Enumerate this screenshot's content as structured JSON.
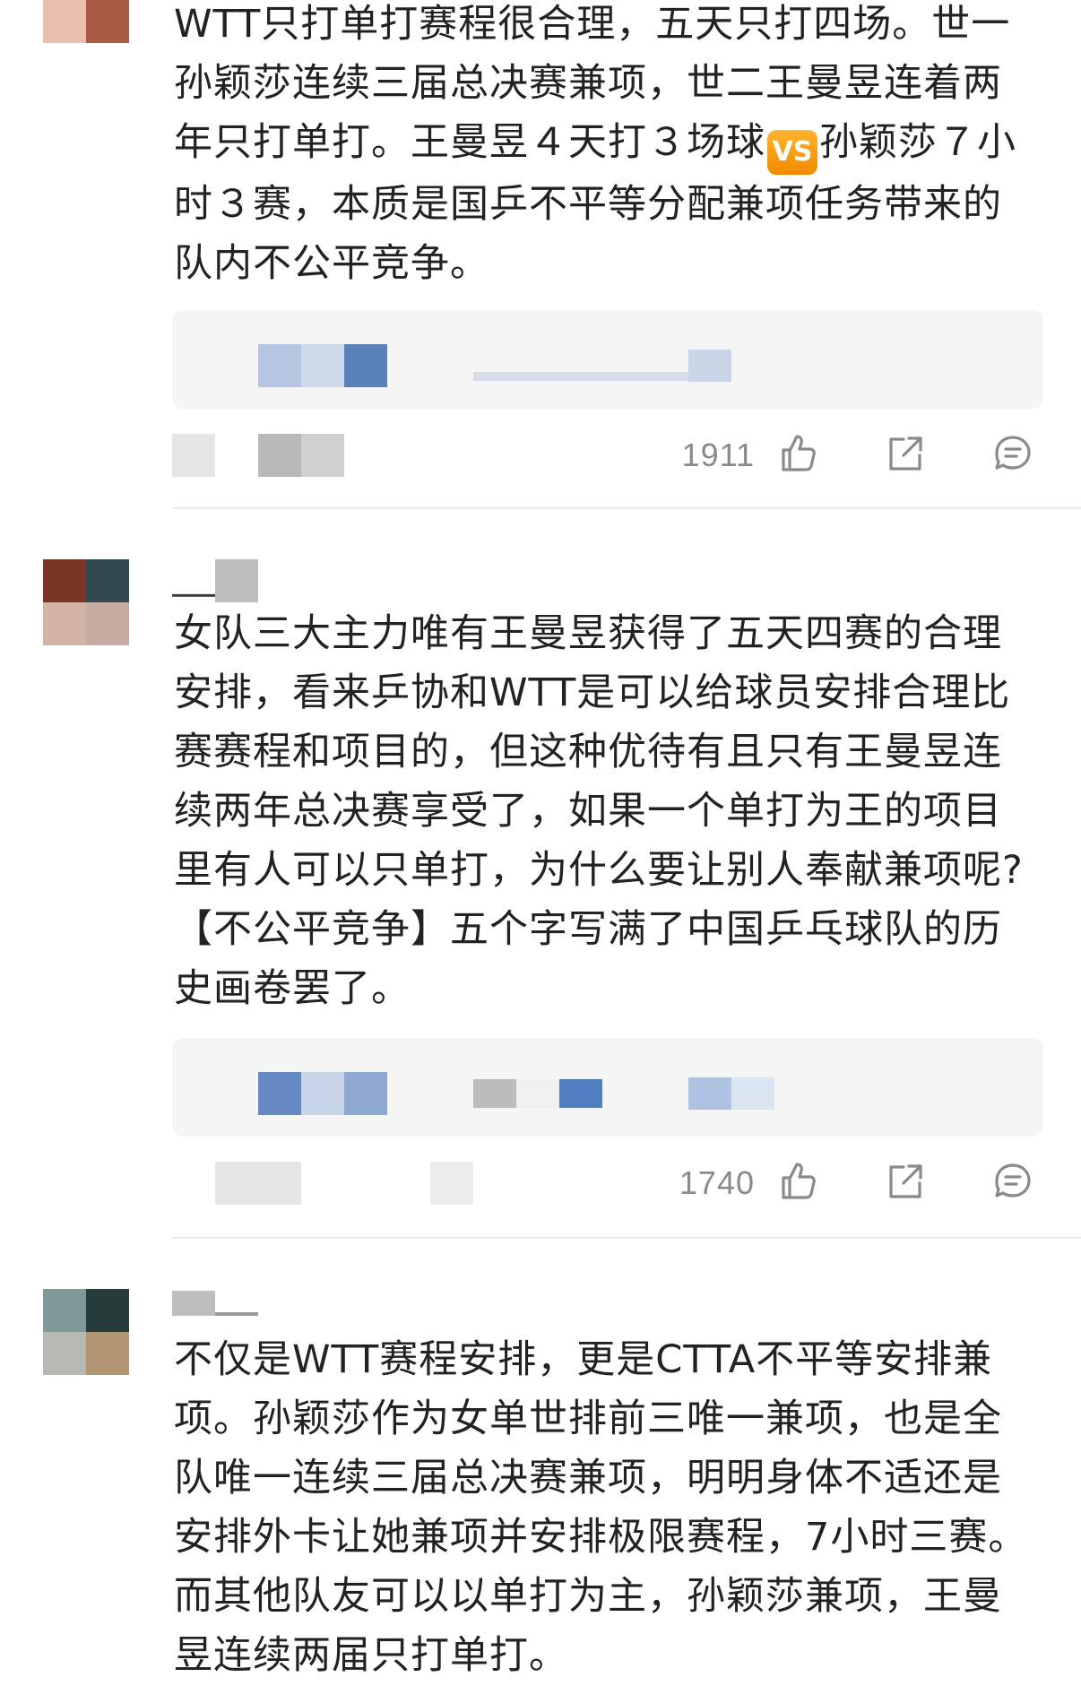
{
  "comments": [
    {
      "text_pre": "WTT只打单打赛程很合理，五天只打四场。世一孙颖莎连续三届总决赛兼项，世二王曼昱连着两年只打单打。王曼昱４天打３场球",
      "badge": "VS",
      "text_post": "孙颖莎７小时３赛，本质是国乒不平等分配兼项任务带来的队内不公平竞争。",
      "likes": "1911"
    },
    {
      "text": "女队三大主力唯有王曼昱获得了五天四赛的合理安排，看来乒协和WTT是可以给球员安排合理比赛赛程和项目的，但这种优待有且只有王曼昱连续两年总决赛享受了，如果一个单打为王的项目里有人可以只单打，为什么要让别人奉献兼项呢?【不公平竞争】五个字写满了中国乒乓球队的历史画卷罢了。",
      "likes": "1740"
    },
    {
      "text": "不仅是WTT赛程安排，更是CTTA不平等安排兼项。孙颖莎作为女单世排前三唯一兼项，也是全队唯一连续三届总决赛兼项，明明身体不适还是安排外卡让她兼项并安排极限赛程，7小时三赛。而其他队友可以以单打为主，孙颖莎兼项，王曼昱连续两届只打单打。"
    }
  ],
  "colors": {
    "text": "#222222",
    "muted": "#8a8a8a",
    "reply_bg": "#f5f5f5",
    "badge": "#f59a0c"
  },
  "icons": [
    "thumbs-up-icon",
    "share-icon",
    "comment-icon"
  ]
}
